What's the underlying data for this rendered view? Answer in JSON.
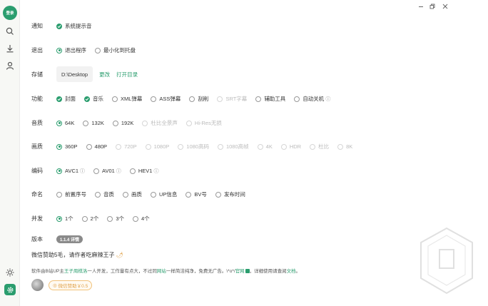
{
  "sidebar": {
    "login_label": "登录"
  },
  "settings": {
    "notify": {
      "label": "通知",
      "option": "系统提示音"
    },
    "exit": {
      "label": "退出",
      "options": [
        "退出程序",
        "最小化到托盘"
      ]
    },
    "storage": {
      "label": "存储",
      "path": "D:\\Desktop",
      "change": "更改",
      "open_dir": "打开目录"
    },
    "features": {
      "label": "功能",
      "options": [
        "封面",
        "音乐",
        "XML弹幕",
        "ASS弹幕",
        "刮削",
        "SRT字幕",
        "辅助工具",
        "自动关机"
      ]
    },
    "audio": {
      "label": "音质",
      "options": [
        "64K",
        "132K",
        "192K",
        "杜比全景声",
        "Hi-Res无损"
      ]
    },
    "video": {
      "label": "画质",
      "options": [
        "360P",
        "480P",
        "720P",
        "1080P",
        "1080高码",
        "1080高帧",
        "4K",
        "HDR",
        "杜比",
        "8K"
      ]
    },
    "codec": {
      "label": "编码",
      "options": [
        "AVC1",
        "AV01",
        "HEV1"
      ]
    },
    "naming": {
      "label": "命名",
      "options": [
        "前置序号",
        "音质",
        "画质",
        "UP信息",
        "BV号",
        "发布时间"
      ]
    },
    "concurrency": {
      "label": "并发",
      "options": [
        "1个",
        "2个",
        "3个",
        "4个"
      ]
    },
    "version": {
      "label": "版本",
      "value": "1.1.4 详情"
    }
  },
  "footer": {
    "donate_title": "微信赞助5毛，请作者吃麻辣王子",
    "desc_a": "软件由B站UP主",
    "author": "王子周棋洛",
    "desc_b": "一人开发，工作量有点大，不过同",
    "site": "网站",
    "desc_c": "一样简洁纯净，免费无广告。\\*o*/",
    "official": "官网",
    "desc_d": "，详细使用请查阅",
    "docs": "文档",
    "desc_e": "。",
    "donate_button": "微信赞助￥0.5"
  },
  "colors": {
    "accent": "#2a9d6e",
    "donate": "#e0a24b"
  }
}
